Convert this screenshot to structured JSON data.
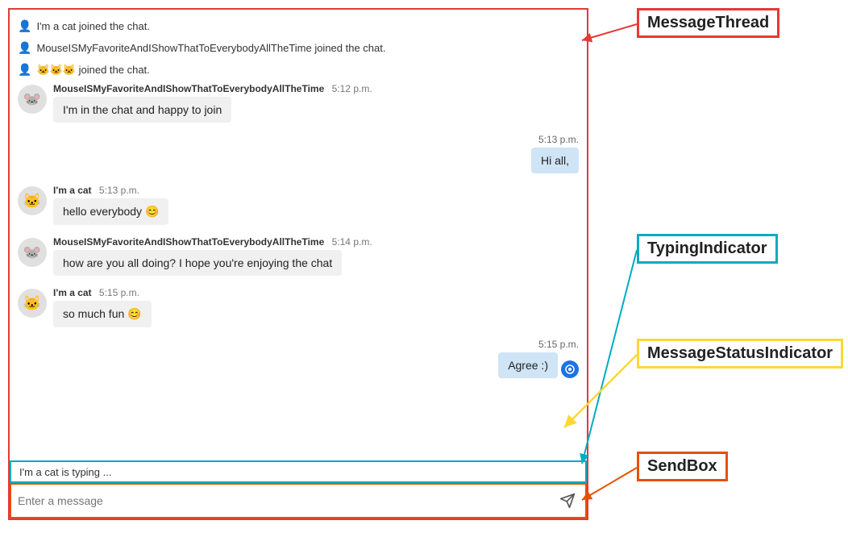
{
  "annotations": {
    "message_thread_label": "MessageThread",
    "typing_indicator_label": "TypingIndicator",
    "message_status_label": "MessageStatusIndicator",
    "send_box_label": "SendBox"
  },
  "system_messages": [
    {
      "id": "sys1",
      "text": "I'm a cat joined the chat."
    },
    {
      "id": "sys2",
      "text": "MouseISMyFavoriteAndIShowThatToEverybodyAllTheTime joined the chat."
    },
    {
      "id": "sys3",
      "text": "🐱🐱🐱 joined the chat."
    }
  ],
  "messages": [
    {
      "id": "msg1",
      "type": "incoming",
      "avatar": "🐭",
      "sender": "MouseISMyFavoriteAndIShowThatToEverybodyAllTheTime",
      "timestamp": "5:12 p.m.",
      "text": "I'm in the chat and happy to join"
    },
    {
      "id": "msg2",
      "type": "own",
      "timestamp": "5:13 p.m.",
      "text": "Hi all,"
    },
    {
      "id": "msg3",
      "type": "incoming",
      "avatar": "🐱",
      "sender": "I'm a cat",
      "timestamp": "5:13 p.m.",
      "text": "hello everybody 😊"
    },
    {
      "id": "msg4",
      "type": "incoming",
      "avatar": "🐭",
      "sender": "MouseISMyFavoriteAndIShowThatToEverybodyAllTheTime",
      "timestamp": "5:14 p.m.",
      "text": "how are you all doing? I hope you're enjoying the chat"
    },
    {
      "id": "msg5",
      "type": "incoming",
      "avatar": "🐱",
      "sender": "I'm a cat",
      "timestamp": "5:15 p.m.",
      "text": "so much fun 😊"
    },
    {
      "id": "msg6",
      "type": "own",
      "timestamp": "5:15 p.m.",
      "text": "Agree :)",
      "hasStatus": true
    }
  ],
  "typing_indicator": {
    "text": "I'm a cat is typing ..."
  },
  "send_box": {
    "placeholder": "Enter a message",
    "send_button_label": "Send"
  }
}
